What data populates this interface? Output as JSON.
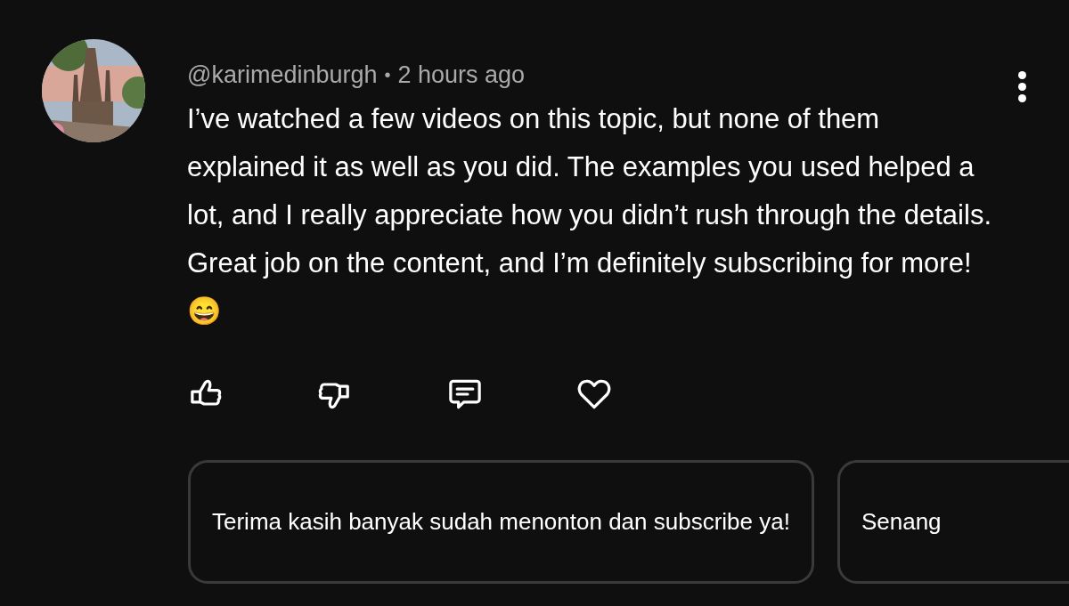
{
  "comment": {
    "author": "@karimedinburgh",
    "separator": "•",
    "time": "2 hours ago",
    "text": "I’ve watched a few videos on this topic, but none of them explained it as well as you did. The examples you used helped a lot, and I really appreciate how you didn’t rush through the details. Great job on the content, and I’m definitely subscribing for more! 😄",
    "actions": [
      {
        "kind": "like"
      },
      {
        "kind": "dislike"
      },
      {
        "kind": "reply"
      },
      {
        "kind": "heart"
      }
    ]
  },
  "suggested_replies": [
    "Terima kasih banyak sudah menonton dan subscribe ya!",
    "Senang"
  ]
}
